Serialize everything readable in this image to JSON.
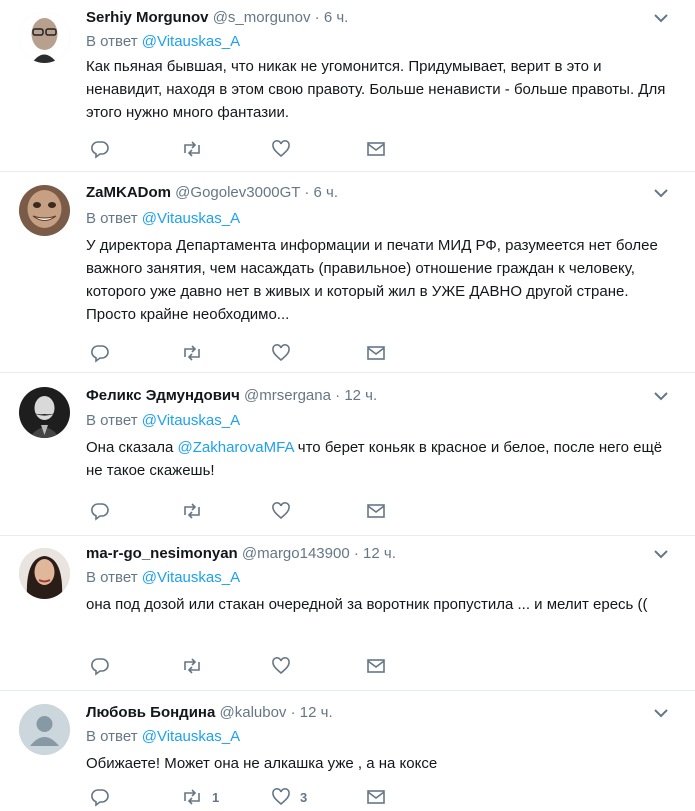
{
  "reply_prefix": "В ответ",
  "tweets": [
    {
      "fullname": "Serhiy Morgunov",
      "username": "@s_morgunov",
      "dot": "·",
      "time": "6 ч.",
      "reply_to": "@Vitauskas_A",
      "text_lines": "Как пьяная бывшая, что никак не угомонится. Придумывает, верит в это и ненавидит, находя в этом свою правоту. Больше ненависти - больше правоты. Для этого нужно много фантазии.",
      "avatar": "bald-man-glasses"
    },
    {
      "fullname": "ZaMKADom",
      "username": "@Gogolev3000GT",
      "dot": "·",
      "time": "6 ч.",
      "reply_to": "@Vitauskas_A",
      "text_lines": "У директора Департамента информации и печати МИД РФ, разумеется нет более важного занятия, чем насаждать (правильное) отношение граждан к человеку, которого уже давно нет в живых и который жил в УЖЕ ДАВНО другой стране. Просто крайне необходимо...",
      "avatar": "grinning-face"
    },
    {
      "fullname": "Феликс Эдмундович",
      "username": "@mrsergana",
      "dot": "·",
      "time": "12 ч.",
      "reply_to": "@Vitauskas_A",
      "text_pre": "Она сказала ",
      "text_mention": "@ZakharovaMFA",
      "text_post": " что берет коньяк в красное и белое, после него ещё не такое скажешь!",
      "avatar": "mustache-man"
    },
    {
      "fullname": "ma-r-go_nesimonyan",
      "username": "@margo143900",
      "dot": "·",
      "time": "12 ч.",
      "reply_to": "@Vitauskas_A",
      "text_lines": "она под дозой или стакан очередной за воротник пропустила ... и мелит ересь ((",
      "avatar": "woman-dark-hair"
    },
    {
      "fullname": "Любовь Бондина",
      "username": "@kalubov",
      "dot": "·",
      "time": "12 ч.",
      "reply_to": "@Vitauskas_A",
      "text_lines": "Обижаете! Может она не алкашка уже , а на коксе",
      "avatar": "default-avatar",
      "retweet_count": "1",
      "like_count": "3"
    }
  ],
  "colors": {
    "text": "#14171a",
    "secondary": "#657786",
    "link": "#1da1f2",
    "divider": "#e6ecf0"
  }
}
